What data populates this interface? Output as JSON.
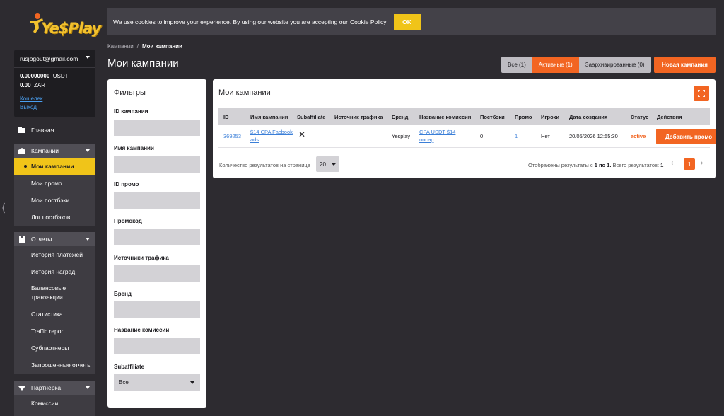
{
  "brand": {
    "logo_text": "Ye$Play"
  },
  "account": {
    "email": "rusjogout@gmail.com",
    "balances": [
      {
        "amount": "0.00000000",
        "currency": "USDT"
      },
      {
        "amount": "0.00",
        "currency": "ZAR"
      }
    ],
    "links": {
      "wallet": "Кошелек",
      "logout": "Выход"
    }
  },
  "nav": {
    "home": "Главная",
    "campaigns": {
      "label": "Кампании",
      "items": [
        "Мои кампании",
        "Мои промо",
        "Мои постбэки",
        "Лог постбэков"
      ]
    },
    "reports": {
      "label": "Отчеты",
      "items": [
        "История платежей",
        "История наград",
        "Балансовые транзакции",
        "Статистика",
        "Traffic report",
        "Субпартнеры",
        "Запрошенные отчеты"
      ]
    },
    "partners": {
      "label": "Партнерка",
      "items": [
        "Комиссии"
      ]
    }
  },
  "cookie": {
    "text": "We use cookies to improve your experience. By using our website you are accepting our",
    "link": "Cookie Policy",
    "ok": "OK"
  },
  "breadcrumb": {
    "root": "Кампании",
    "sep": "/",
    "current": "Мои кампании"
  },
  "page_title": "Мои кампании",
  "filter_tabs": {
    "all": "Все (1)",
    "active": "Активные (1)",
    "archived": "Заархивированные (0)"
  },
  "new_campaign": "Новая кампания",
  "filters": {
    "title": "Фильтры",
    "campaign_id": "ID кампании",
    "campaign_name": "Имя кампании",
    "promo_id": "ID промо",
    "promocode": "Промокод",
    "traffic_sources": "Источники трафика",
    "brand": "Бренд",
    "commission_name": "Название комиссии",
    "subaffiliate": "Subaffiliate",
    "subaffiliate_value": "Все"
  },
  "table": {
    "title": "Мои кампании",
    "headers": {
      "id": "ID",
      "name": "Имя кампании",
      "subaffiliate": "Subaffiliate",
      "traffic": "Источник трафика",
      "brand": "Бренд",
      "commission": "Название комиссии",
      "postbacks": "Постбэки",
      "promo": "Промо",
      "players": "Игроки",
      "created": "Дата создания",
      "status": "Статус",
      "actions": "Действия"
    },
    "row": {
      "id": "369253",
      "name": "$14 CPA Facbook ads",
      "subaffiliate": "✕",
      "traffic": "",
      "brand": "Yesplay",
      "commission": "CPA USDT $14 uncap",
      "postbacks": "0",
      "promo": "1",
      "players": "Нет",
      "created": "20/05/2026 12:55:30",
      "status": "active",
      "action": "Добавить промо"
    },
    "per_page_label": "Количество результатов на странице",
    "per_page": "20",
    "results_prefix": "Отображены результаты с",
    "results_range": "1 по 1.",
    "results_total_label": "Всего результатов:",
    "results_total": "1",
    "current_page": "1"
  }
}
